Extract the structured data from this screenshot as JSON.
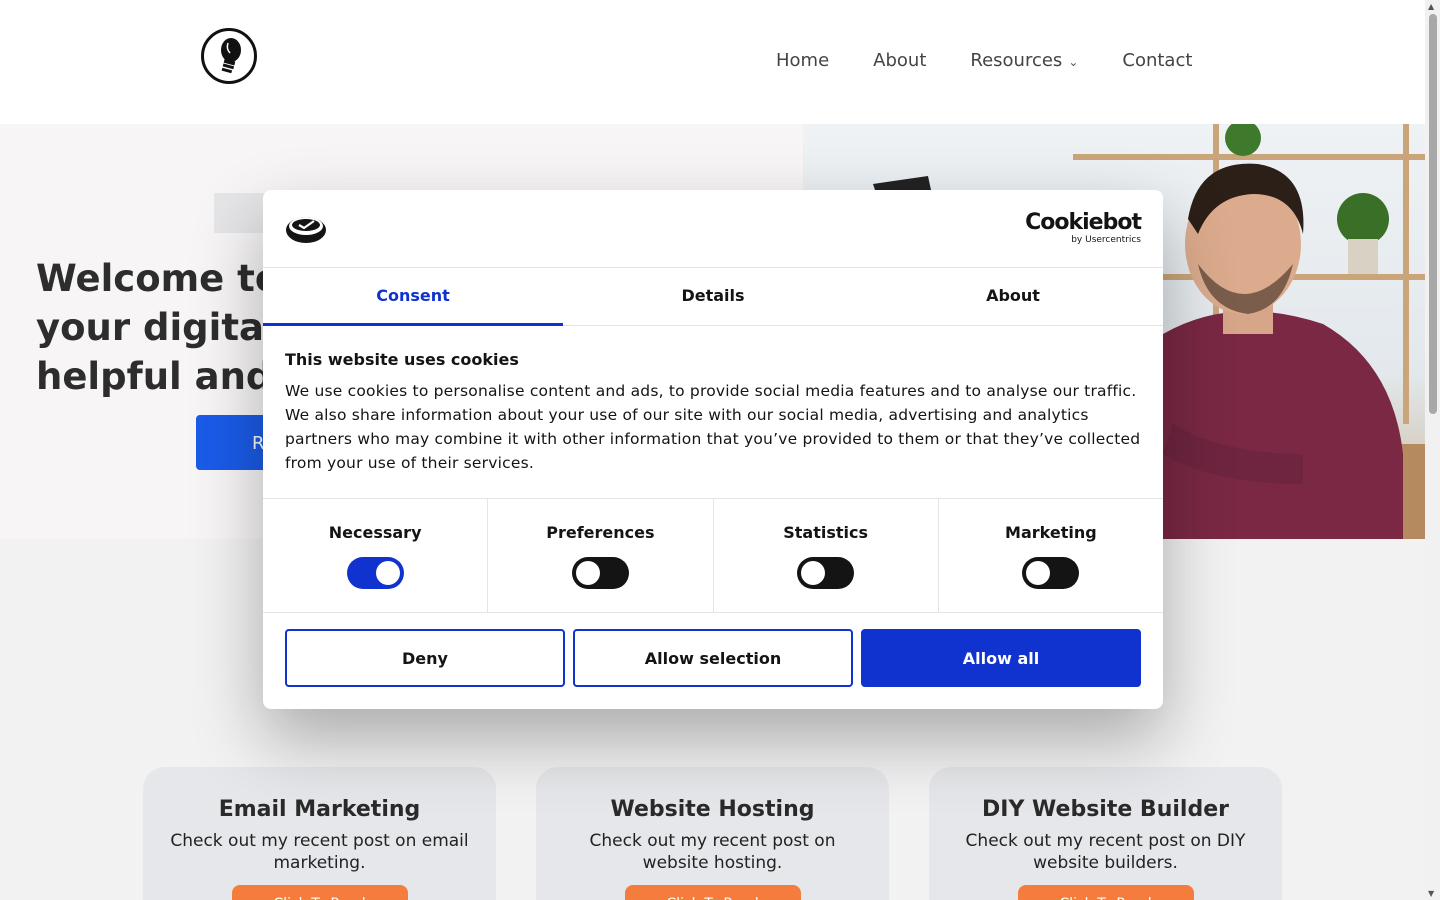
{
  "header": {
    "logo_icon": "lightbulb-logo-icon",
    "nav": [
      "Home",
      "About",
      "Resources",
      "Contact"
    ]
  },
  "hero": {
    "title_lines": [
      "Welcome to",
      "your digital h",
      "helpful and i"
    ],
    "button_label": "R"
  },
  "cards": [
    {
      "title": "Email Marketing",
      "desc": "Check out my recent post on email marketing.",
      "button": "Click To Read"
    },
    {
      "title": "Website Hosting",
      "desc": "Check out my recent post on website hosting.",
      "button": "Click To Read"
    },
    {
      "title": "DIY Website Builder",
      "desc": "Check out my recent post on DIY website builders.",
      "button": "Click To Read"
    }
  ],
  "cookie_dialog": {
    "brand_name": "Cookiebot",
    "brand_sub": "by Usercentrics",
    "tabs": [
      "Consent",
      "Details",
      "About"
    ],
    "active_tab": "Consent",
    "title": "This website uses cookies",
    "text": "We use cookies to personalise content and ads, to provide social media features and to analyse our traffic. We also share information about your use of our site with our social media, advertising and analytics partners who may combine it with other information that you’ve provided to them or that they’ve collected from your use of their services.",
    "categories": [
      {
        "label": "Necessary",
        "on": true
      },
      {
        "label": "Preferences",
        "on": false
      },
      {
        "label": "Statistics",
        "on": false
      },
      {
        "label": "Marketing",
        "on": false
      }
    ],
    "buttons": {
      "deny": "Deny",
      "allow_selection": "Allow selection",
      "allow_all": "Allow all"
    },
    "accent_color": "#1032cf"
  },
  "colors": {
    "hero_button": "#1a5be8",
    "card_button": "#f47c3c"
  }
}
